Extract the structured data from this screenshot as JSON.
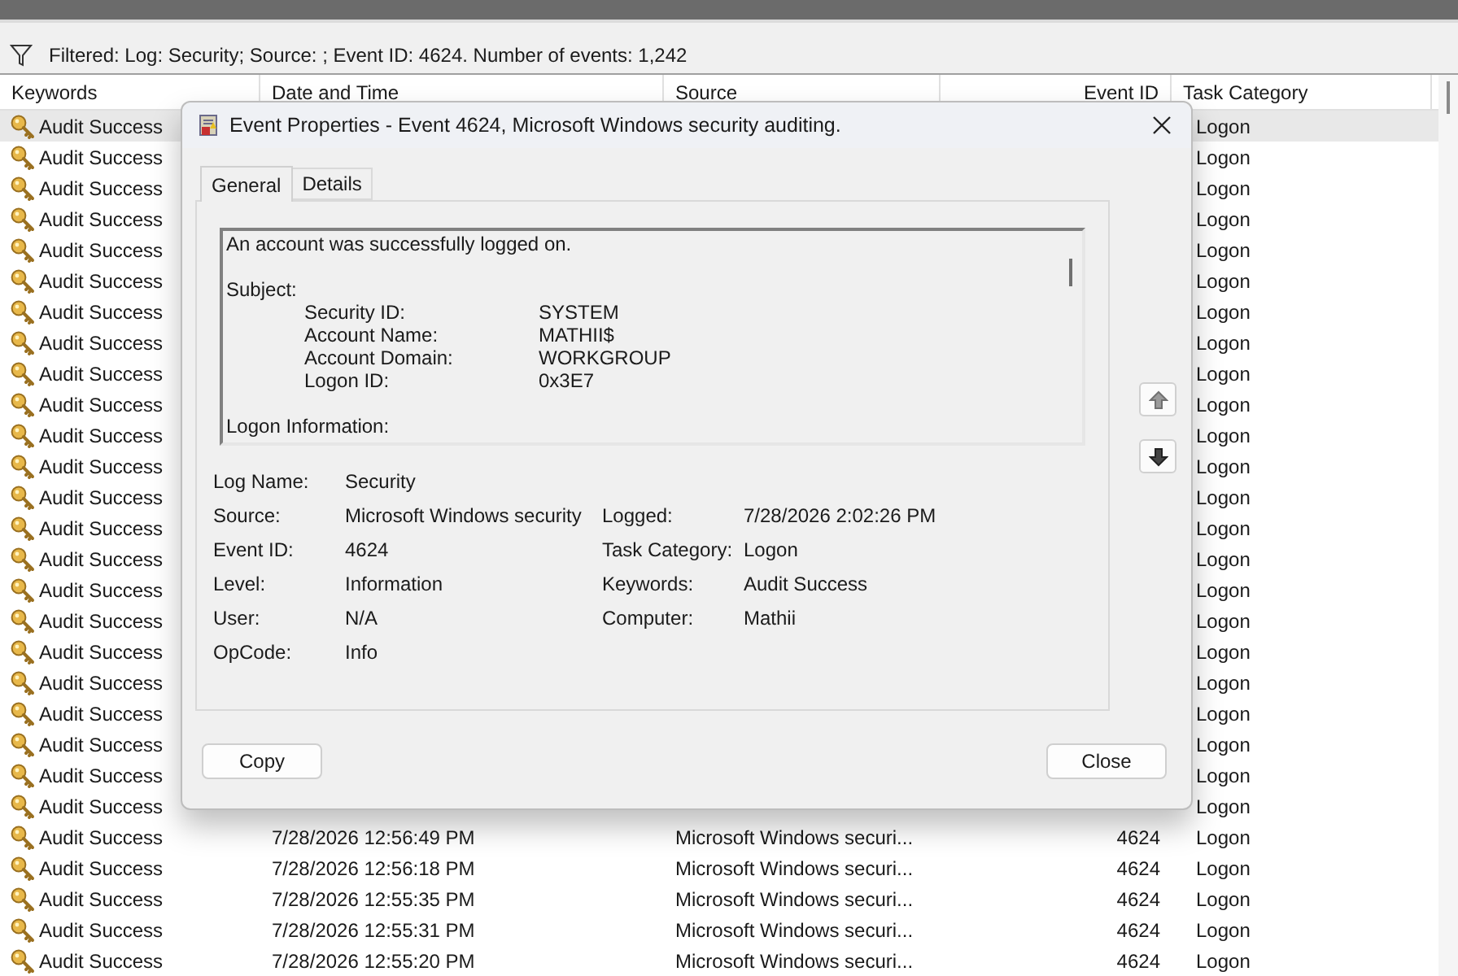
{
  "header": {
    "kind": "strip"
  },
  "filter": {
    "text": "Filtered: Log: Security; Source: ; Event ID: 4624. Number of events: 1,242"
  },
  "table": {
    "columns": [
      "Keywords",
      "Date and Time",
      "Source",
      "Event ID",
      "Task Category"
    ],
    "rows": [
      {
        "selected": true,
        "keywords": "Audit Success",
        "task_category": "Logon"
      },
      {
        "selected": false,
        "keywords": "Audit Success",
        "task_category": "Logon"
      },
      {
        "selected": false,
        "keywords": "Audit Success",
        "task_category": "Logon"
      },
      {
        "selected": false,
        "keywords": "Audit Success",
        "task_category": "Logon"
      },
      {
        "selected": false,
        "keywords": "Audit Success",
        "task_category": "Logon"
      },
      {
        "selected": false,
        "keywords": "Audit Success",
        "task_category": "Logon"
      },
      {
        "selected": false,
        "keywords": "Audit Success",
        "task_category": "Logon"
      },
      {
        "selected": false,
        "keywords": "Audit Success",
        "task_category": "Logon"
      },
      {
        "selected": false,
        "keywords": "Audit Success",
        "task_category": "Logon"
      },
      {
        "selected": false,
        "keywords": "Audit Success",
        "task_category": "Logon"
      },
      {
        "selected": false,
        "keywords": "Audit Success",
        "task_category": "Logon"
      },
      {
        "selected": false,
        "keywords": "Audit Success",
        "task_category": "Logon"
      },
      {
        "selected": false,
        "keywords": "Audit Success",
        "task_category": "Logon"
      },
      {
        "selected": false,
        "keywords": "Audit Success",
        "task_category": "Logon"
      },
      {
        "selected": false,
        "keywords": "Audit Success",
        "task_category": "Logon"
      },
      {
        "selected": false,
        "keywords": "Audit Success",
        "task_category": "Logon"
      },
      {
        "selected": false,
        "keywords": "Audit Success",
        "task_category": "Logon"
      },
      {
        "selected": false,
        "keywords": "Audit Success",
        "task_category": "Logon"
      },
      {
        "selected": false,
        "keywords": "Audit Success",
        "task_category": "Logon"
      },
      {
        "selected": false,
        "keywords": "Audit Success",
        "task_category": "Logon"
      },
      {
        "selected": false,
        "keywords": "Audit Success",
        "task_category": "Logon"
      },
      {
        "selected": false,
        "keywords": "Audit Success",
        "task_category": "Logon"
      },
      {
        "selected": false,
        "keywords": "Audit Success",
        "task_category": "Logon"
      },
      {
        "selected": false,
        "keywords": "Audit Success",
        "date_time": "7/28/2026 12:56:49 PM",
        "source": "Microsoft Windows securi...",
        "event_id": "4624",
        "task_category": "Logon"
      },
      {
        "selected": false,
        "keywords": "Audit Success",
        "date_time": "7/28/2026 12:56:18 PM",
        "source": "Microsoft Windows securi...",
        "event_id": "4624",
        "task_category": "Logon"
      },
      {
        "selected": false,
        "keywords": "Audit Success",
        "date_time": "7/28/2026 12:55:35 PM",
        "source": "Microsoft Windows securi...",
        "event_id": "4624",
        "task_category": "Logon"
      },
      {
        "selected": false,
        "keywords": "Audit Success",
        "date_time": "7/28/2026 12:55:31 PM",
        "source": "Microsoft Windows securi...",
        "event_id": "4624",
        "task_category": "Logon"
      },
      {
        "selected": false,
        "keywords": "Audit Success",
        "date_time": "7/28/2026 12:55:20 PM",
        "source": "Microsoft Windows securi...",
        "event_id": "4624",
        "task_category": "Logon"
      }
    ]
  },
  "dialog": {
    "title": "Event Properties - Event 4624, Microsoft Windows security auditing.",
    "tabs": [
      {
        "label": "General",
        "selected": true
      },
      {
        "label": "Details",
        "selected": false
      }
    ],
    "description": [
      {
        "kind": "text",
        "text": "An account was successfully logged on."
      },
      {
        "kind": "blank"
      },
      {
        "kind": "text",
        "text": "Subject:"
      },
      {
        "kind": "field",
        "label": "Security ID:",
        "value": "SYSTEM"
      },
      {
        "kind": "field",
        "label": "Account Name:",
        "value": "MATHII$"
      },
      {
        "kind": "field",
        "label": "Account Domain:",
        "value": "WORKGROUP"
      },
      {
        "kind": "field",
        "label": "Logon ID:",
        "value": "0x3E7"
      },
      {
        "kind": "blank"
      },
      {
        "kind": "text",
        "text": "Logon Information:"
      }
    ],
    "fields": [
      {
        "label": "Log Name:",
        "value": "Security"
      },
      {
        "label": "Source:",
        "value": "Microsoft Windows security"
      },
      {
        "label": "Logged:",
        "value": "7/28/2026 2:02:26 PM"
      },
      {
        "label": "Event ID:",
        "value": "4624"
      },
      {
        "label": "Task Category:",
        "value": "Logon"
      },
      {
        "label": "Level:",
        "value": "Information"
      },
      {
        "label": "Keywords:",
        "value": "Audit Success"
      },
      {
        "label": "User:",
        "value": "N/A"
      },
      {
        "label": "Computer:",
        "value": "Mathii"
      },
      {
        "label": "OpCode:",
        "value": "Info"
      }
    ],
    "buttons": [
      "Copy",
      "Close"
    ]
  }
}
